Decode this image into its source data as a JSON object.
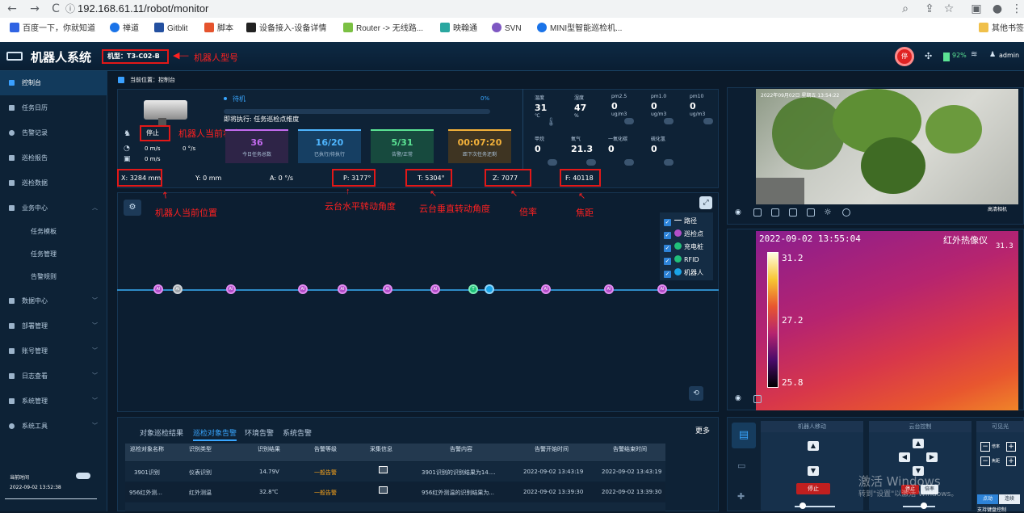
{
  "browser": {
    "url": "192.168.61.11/robot/monitor",
    "bookmarks": [
      "百度一下，你就知道",
      "禅道",
      "Gitblit",
      "脚本",
      "设备接入-设备详情",
      "Router -> 无线路...",
      "映翰通",
      "SVN",
      "MINI型智能巡检机..."
    ],
    "other_bookmarks": "其他书签",
    "icons": {
      "back": "←",
      "forward": "→",
      "reload": "C",
      "info": "ⓘ",
      "zoom": "⌕",
      "share": "⇪",
      "star": "☆",
      "sidebar": "▣",
      "profile": "●",
      "menu": "⋮"
    }
  },
  "header": {
    "title": "机器人系统",
    "model": "机型：T3-C02-B",
    "model_note": "机器人型号",
    "battery": "92%",
    "user": "admin",
    "stop_label": "停"
  },
  "sidebar": {
    "items": [
      {
        "label": "控制台",
        "active": true
      },
      {
        "label": "任务日历"
      },
      {
        "label": "告警记录"
      },
      {
        "label": "巡检报告"
      },
      {
        "label": "巡检数据"
      },
      {
        "label": "业务中心",
        "expanded": true
      },
      {
        "label": "任务模板",
        "sub": true
      },
      {
        "label": "任务管理",
        "sub": true
      },
      {
        "label": "告警规则",
        "sub": true
      },
      {
        "label": "数据中心"
      },
      {
        "label": "部署管理"
      },
      {
        "label": "账号管理"
      },
      {
        "label": "日志查看"
      },
      {
        "label": "系统管理"
      },
      {
        "label": "系统工具"
      }
    ],
    "time_label": "当前时间",
    "time_value": "2022-09-02 13:52:38"
  },
  "breadcrumb": "当前位置：控制台",
  "robot": {
    "state": "停止",
    "state_note": "机器人当前状态",
    "speed": "0 m/s",
    "angular": "0 °/s",
    "speed2": "0 m/s",
    "task_status": "待机",
    "progress_label": "0%",
    "progress": 0,
    "next_task": "即将执行: 任务巡检点维度"
  },
  "stats": [
    {
      "value": "36",
      "label": "今日任务总数",
      "color": "#c46bf0",
      "bg": "#2e2447"
    },
    {
      "value": "16/20",
      "label": "已执行/待执行",
      "color": "#4fb6ff",
      "bg": "#163f63"
    },
    {
      "value": "5/31",
      "label": "告警/正常",
      "color": "#5be394",
      "bg": "#174a3e"
    },
    {
      "value": "00:07:20",
      "label": "距下次任务还剩",
      "color": "#f3b13a",
      "bg": "#3e3422"
    }
  ],
  "readouts": {
    "x": "X: 3284 mm",
    "y": "Y: 0 mm",
    "a": "A: 0 °/s",
    "p": "P: 3177°",
    "t": "T: 5304°",
    "z": "Z: 7077",
    "f": "F: 40118"
  },
  "annotations": {
    "pos": "机器人当前位置",
    "pan": "云台水平转动角度",
    "tilt": "云台垂直转动角度",
    "zoom": "倍率",
    "focus": "焦距"
  },
  "environment": [
    {
      "label": "温度",
      "value": "31",
      "unit": "℃"
    },
    {
      "label": "湿度",
      "value": "47",
      "unit": "%"
    },
    {
      "label": "pm2.5",
      "value": "0",
      "unit": "ug/m3"
    },
    {
      "label": "pm1.0",
      "value": "0",
      "unit": "ug/m3"
    },
    {
      "label": "pm10",
      "value": "0",
      "unit": "ug/m3"
    },
    {
      "label": "甲烷",
      "value": "0",
      "unit": ""
    },
    {
      "label": "氧气",
      "value": "21.3",
      "unit": ""
    },
    {
      "label": "一氧化碳",
      "value": "0",
      "unit": ""
    },
    {
      "label": "硫化氢",
      "value": "0",
      "unit": ""
    }
  ],
  "legend": [
    "路径",
    "巡检点",
    "充电桩",
    "RFID",
    "机器人"
  ],
  "map": {
    "node_label": "AI",
    "charge_label": "T"
  },
  "camera": {
    "timestamp": "2022年09月02日 星期五 13:54:22",
    "name": "高清相机"
  },
  "thermal": {
    "timestamp": "2022-09-02 13:55:04",
    "title": "红外热像仪",
    "max": "31.2",
    "mid": "27.2",
    "min": "25.8",
    "max2": "31.3"
  },
  "alarms": {
    "tabs": [
      "对象巡检结果",
      "巡检对象告警",
      "环境告警",
      "系统告警"
    ],
    "more": "更多",
    "columns": [
      "巡检对象名称",
      "识别类型",
      "识别结果",
      "告警等级",
      "采集信息",
      "告警内容",
      "告警开始时间",
      "告警结束时间"
    ],
    "rows": [
      {
        "name": "3901识别",
        "type": "仪表识别",
        "result": "14.79V",
        "level": "一般告警",
        "content": "3901识别的识别结果为14....",
        "start": "2022-09-02 13:43:19",
        "end": "2022-09-02 13:43:19"
      },
      {
        "name": "956红外测...",
        "type": "红外测温",
        "result": "32.8℃",
        "level": "一般告警",
        "content": "956红外测温的识别结果为...",
        "start": "2022-09-02 13:39:30",
        "end": "2022-09-02 13:39:30"
      }
    ]
  },
  "controls": {
    "robot_move": "机器人移动",
    "ptz": "云台控制",
    "visible": "可见光",
    "stop": "停止",
    "double_speed": "倍率",
    "focus": "焦距",
    "point": "点动",
    "continuous": "连续",
    "support_key": "支持键盘控制"
  },
  "watermark": {
    "line1": "激活 Windows",
    "line2": "转到\"设置\"以激活 Windows。"
  }
}
